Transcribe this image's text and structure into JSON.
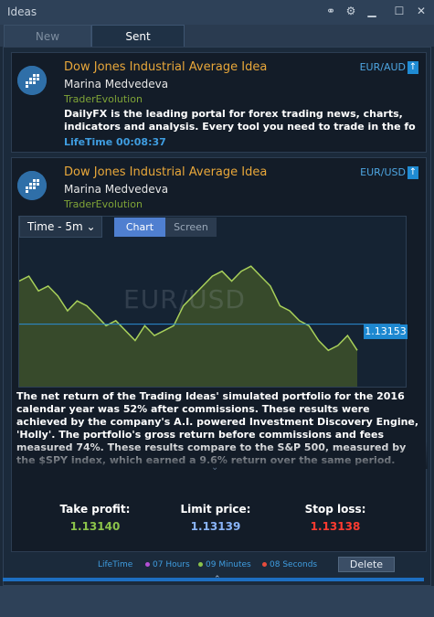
{
  "window": {
    "title": "Ideas",
    "controls": [
      "link-icon",
      "settings-icon",
      "minimize-icon",
      "maximize-icon",
      "close-icon"
    ]
  },
  "tabs": [
    {
      "label": "New",
      "active": false
    },
    {
      "label": "Sent",
      "active": true
    }
  ],
  "ideas": [
    {
      "title": "Dow Jones Industrial Average Idea",
      "author": "Marina Medvedeva",
      "source": "TraderEvolution",
      "pair": "EUR/AUD",
      "desc_line1": "DailyFX is the leading portal for forex trading news, charts,",
      "desc_line2": "indicators and analysis. Every tool you need to trade in the forei...",
      "lifetime": "LifeTime 00:08:37"
    },
    {
      "title": "Dow Jones Industrial Average Idea",
      "author": "Marina Medvedeva",
      "source": "TraderEvolution",
      "pair": "EUR/USD",
      "time_selector": "Time - 5m",
      "view_tabs": [
        "Chart",
        "Screen"
      ],
      "active_view": "Chart",
      "chart_watermark": "EUR/USD",
      "current_price": "1.13153",
      "text": "The net return of the Trading Ideas' simulated portfolio for the 2016 calendar year was 52% after commissions. These results were achieved by the company's A.I. powered Investment Discovery Engine, 'Holly'. The portfolio's gross return before commissions and fees measured 74%. These results compare to the S&P 500, measured by the $SPY index, which earned a 9.6% return over the same period.",
      "take_profit_label": "Take profit:",
      "take_profit": "1.13140",
      "limit_price_label": "Limit price:",
      "limit_price": "1.13139",
      "stop_loss_label": "Stop loss:",
      "stop_loss": "1.13138",
      "footer_lifetime": "LifeTime",
      "hours": "07 Hours",
      "minutes": "09 Minutes",
      "seconds": "08 Seconds",
      "delete_label": "Delete"
    }
  ],
  "colors": {
    "accent": "#3f9de0",
    "title": "#e8a73a",
    "source": "#7fa437",
    "take_profit": "#8bc34a",
    "limit_price": "#8ab4f8",
    "stop_loss": "#ff3b30"
  },
  "chart_data": {
    "type": "area",
    "series": [
      {
        "values": [
          1.1324,
          1.1325,
          1.1322,
          1.1323,
          1.1321,
          1.1318,
          1.132,
          1.1319,
          1.1317,
          1.1315,
          1.1316,
          1.1314,
          1.1312,
          1.1315,
          1.1313,
          1.1314,
          1.1315,
          1.1319,
          1.1321,
          1.1323,
          1.1325,
          1.1326,
          1.1324,
          1.1326,
          1.1327,
          1.1325,
          1.1323,
          1.1319,
          1.1318,
          1.1316,
          1.1315,
          1.1312,
          1.131,
          1.1311,
          1.1313,
          1.131
        ]
      }
    ],
    "price_line": 1.13153
  }
}
